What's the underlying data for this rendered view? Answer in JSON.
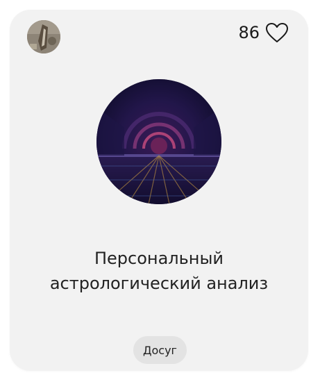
{
  "card": {
    "likes_count": "86",
    "title": "Персональный\nастрологический анализ",
    "tag_label": "Досуг",
    "icons": {
      "avatar": "author-avatar",
      "like": "heart-outline-icon"
    },
    "colors": {
      "card_background": "#f2f2f2",
      "tag_background": "#e3e3e3",
      "text": "#222222",
      "cover_background": "#1b1340"
    }
  }
}
